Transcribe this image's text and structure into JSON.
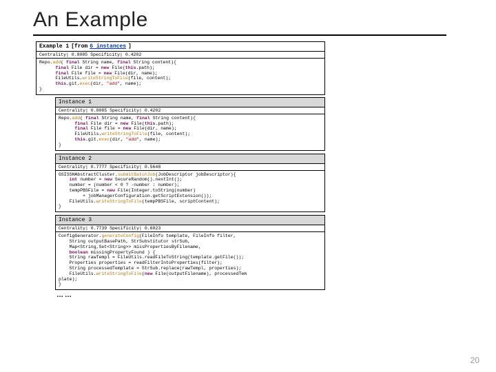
{
  "title": "An Example",
  "example": {
    "label": "Example 1",
    "from": "[from",
    "link": "6 instances",
    "close": "]",
    "metrics": "Centrality| 0.8085  Specificity| 0.4202",
    "code": [
      {
        "t": "p",
        "v": "Repo."
      },
      {
        "t": "fn",
        "v": "add"
      },
      {
        "t": "p",
        "v": "( "
      },
      {
        "t": "kw",
        "v": "final"
      },
      {
        "t": "p",
        "v": " String name, "
      },
      {
        "t": "kw",
        "v": "final"
      },
      {
        "t": "p",
        "v": " String content){"
      },
      {
        "t": "nl"
      },
      {
        "t": "p",
        "v": "      "
      },
      {
        "t": "kw",
        "v": "final"
      },
      {
        "t": "p",
        "v": " File dir = "
      },
      {
        "t": "kw",
        "v": "new"
      },
      {
        "t": "p",
        "v": " File("
      },
      {
        "t": "kw",
        "v": "this"
      },
      {
        "t": "p",
        "v": ".path);"
      },
      {
        "t": "nl"
      },
      {
        "t": "p",
        "v": "      "
      },
      {
        "t": "kw",
        "v": "final"
      },
      {
        "t": "p",
        "v": " File file = "
      },
      {
        "t": "kw",
        "v": "new"
      },
      {
        "t": "p",
        "v": " File(dir, name);"
      },
      {
        "t": "nl"
      },
      {
        "t": "p",
        "v": "      FileUtils."
      },
      {
        "t": "fn",
        "v": "writeStringToFile"
      },
      {
        "t": "p",
        "v": "(file, content);"
      },
      {
        "t": "nl"
      },
      {
        "t": "p",
        "v": "      "
      },
      {
        "t": "kw",
        "v": "this"
      },
      {
        "t": "p",
        "v": ".git."
      },
      {
        "t": "fn",
        "v": "exec"
      },
      {
        "t": "p",
        "v": "(dir, "
      },
      {
        "t": "str",
        "v": "\"add\""
      },
      {
        "t": "p",
        "v": ", name);"
      },
      {
        "t": "nl"
      },
      {
        "t": "p",
        "v": "}"
      }
    ]
  },
  "instances": [
    {
      "title": "Instance 1",
      "metrics": "Centrality| 0.8085  Specificity| 0.4202",
      "code": [
        {
          "t": "p",
          "v": "Repo."
        },
        {
          "t": "fn",
          "v": "add"
        },
        {
          "t": "p",
          "v": "( "
        },
        {
          "t": "kw",
          "v": "final"
        },
        {
          "t": "p",
          "v": " String name, "
        },
        {
          "t": "kw",
          "v": "final"
        },
        {
          "t": "p",
          "v": " String content){"
        },
        {
          "t": "nl"
        },
        {
          "t": "p",
          "v": "      "
        },
        {
          "t": "kw",
          "v": "final"
        },
        {
          "t": "p",
          "v": " File dir = "
        },
        {
          "t": "kw",
          "v": "new"
        },
        {
          "t": "p",
          "v": " File("
        },
        {
          "t": "kw",
          "v": "this"
        },
        {
          "t": "p",
          "v": ".path);"
        },
        {
          "t": "nl"
        },
        {
          "t": "p",
          "v": "      "
        },
        {
          "t": "kw",
          "v": "final"
        },
        {
          "t": "p",
          "v": " File file = "
        },
        {
          "t": "kw",
          "v": "new"
        },
        {
          "t": "p",
          "v": " File(dir, name);"
        },
        {
          "t": "nl"
        },
        {
          "t": "p",
          "v": "      FileUtils."
        },
        {
          "t": "fn",
          "v": "writeStringToFile"
        },
        {
          "t": "p",
          "v": "(file, content);"
        },
        {
          "t": "nl"
        },
        {
          "t": "p",
          "v": "      "
        },
        {
          "t": "kw",
          "v": "this"
        },
        {
          "t": "p",
          "v": ".git."
        },
        {
          "t": "fn",
          "v": "exec"
        },
        {
          "t": "p",
          "v": "(dir, "
        },
        {
          "t": "str",
          "v": "\"add\""
        },
        {
          "t": "p",
          "v": ", name);"
        },
        {
          "t": "nl"
        },
        {
          "t": "p",
          "v": "}"
        }
      ]
    },
    {
      "title": "Instance 2",
      "metrics": "Centrality| 0.7777  Specificity| 0.5648",
      "code": [
        {
          "t": "p",
          "v": "GSISSHAbstractCluster."
        },
        {
          "t": "fn",
          "v": "submitBatchJob"
        },
        {
          "t": "p",
          "v": "(JobDescriptor jobDescriptor){"
        },
        {
          "t": "nl"
        },
        {
          "t": "p",
          "v": "    "
        },
        {
          "t": "kw",
          "v": "int"
        },
        {
          "t": "p",
          "v": " number = "
        },
        {
          "t": "kw",
          "v": "new"
        },
        {
          "t": "p",
          "v": " SecureRandom().nextInt();"
        },
        {
          "t": "nl"
        },
        {
          "t": "p",
          "v": "    number = (number < 0 ? -number : number);"
        },
        {
          "t": "nl"
        },
        {
          "t": "p",
          "v": "    tempPBSFile = "
        },
        {
          "t": "kw",
          "v": "new"
        },
        {
          "t": "p",
          "v": " File(Integer.toString(number)"
        },
        {
          "t": "nl"
        },
        {
          "t": "p",
          "v": "         + jobManagerConfiguration.getScriptExtension());"
        },
        {
          "t": "nl"
        },
        {
          "t": "p",
          "v": "    FileUtils."
        },
        {
          "t": "fn",
          "v": "writeStringToFile"
        },
        {
          "t": "p",
          "v": "(tempPBSFile, scriptContent);"
        },
        {
          "t": "nl"
        },
        {
          "t": "p",
          "v": "}"
        }
      ]
    },
    {
      "title": "Instance 3",
      "metrics": "Centrality| 0.7739  Specificity| 0.6023",
      "code": [
        {
          "t": "p",
          "v": "ConfigGenerator."
        },
        {
          "t": "fn",
          "v": "generateConfig"
        },
        {
          "t": "p",
          "v": "(FileInfo template, FileInfo filter,"
        },
        {
          "t": "nl"
        },
        {
          "t": "p",
          "v": "    String outputBasePath, StrSubstitutor strSub,"
        },
        {
          "t": "nl"
        },
        {
          "t": "p",
          "v": "    Map<String,Set<String>> missPropertiesByFilename,"
        },
        {
          "t": "nl"
        },
        {
          "t": "p",
          "v": "    "
        },
        {
          "t": "kw",
          "v": "boolean"
        },
        {
          "t": "p",
          "v": " missingPropertyFound ) {"
        },
        {
          "t": "nl"
        },
        {
          "t": "p",
          "v": "    String rawTempl = FileUtils.readFileToString(template.getFile());"
        },
        {
          "t": "nl"
        },
        {
          "t": "p",
          "v": "    Properties properties = readFilterIntoProperties(filter);"
        },
        {
          "t": "nl"
        },
        {
          "t": "p",
          "v": "    String processedTemplate = StrSub.replace(rawTempl, properties);"
        },
        {
          "t": "nl"
        },
        {
          "t": "p",
          "v": "    FileUtils."
        },
        {
          "t": "fn",
          "v": "writeStringToFile"
        },
        {
          "t": "p",
          "v": "("
        },
        {
          "t": "kw",
          "v": "new"
        },
        {
          "t": "p",
          "v": " File(outputFilename), processedTem"
        },
        {
          "t": "nl"
        },
        {
          "t": "p",
          "v": "plate);"
        },
        {
          "t": "nl"
        },
        {
          "t": "p",
          "v": "}"
        }
      ]
    }
  ],
  "dots": "……",
  "pagenum": "20"
}
